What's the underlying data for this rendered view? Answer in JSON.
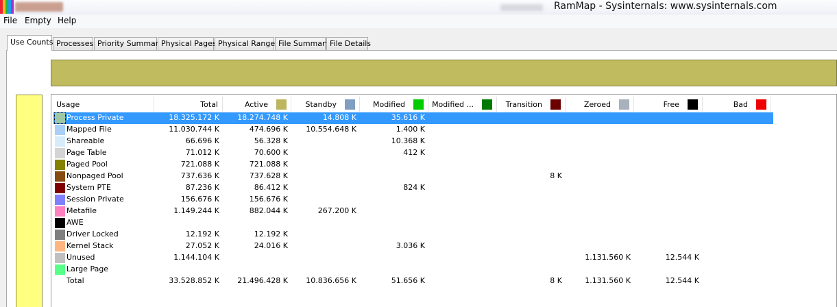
{
  "window": {
    "title": "RamMap - Sysinternals: www.sysinternals.com",
    "icon": "rammap-app-icon"
  },
  "menu": {
    "items": [
      "File",
      "Empty",
      "Help"
    ]
  },
  "tabs": [
    {
      "label": "Use Counts",
      "active": true
    },
    {
      "label": "Processes"
    },
    {
      "label": "Priority Summary"
    },
    {
      "label": "Physical Pages"
    },
    {
      "label": "Physical Ranges"
    },
    {
      "label": "File Summary"
    },
    {
      "label": "File Details"
    }
  ],
  "columns": [
    {
      "label": "Usage",
      "color": null
    },
    {
      "label": "Total",
      "color": null
    },
    {
      "label": "Active",
      "color": "#bdb65f"
    },
    {
      "label": "Standby",
      "color": "#7f9ec1"
    },
    {
      "label": "Modified",
      "color": "#00cc00"
    },
    {
      "label": "Modified ...",
      "color": "#007a00"
    },
    {
      "label": "Transition",
      "color": "#6b0000"
    },
    {
      "label": "Zeroed",
      "color": "#a9b1bd"
    },
    {
      "label": "Free",
      "color": "#000000"
    },
    {
      "label": "Bad",
      "color": "#ee0000"
    }
  ],
  "rows": [
    {
      "usage": "Process Private",
      "color": "#9ec7a6",
      "selected": true,
      "total": "18.325.172 K",
      "active": "18.274.748 K",
      "standby": "14.808 K",
      "modified": "35.616 K",
      "modified_nw": "",
      "transition": "",
      "zeroed": "",
      "free": "",
      "bad": ""
    },
    {
      "usage": "Mapped File",
      "color": "#a9cff6",
      "total": "11.030.744 K",
      "active": "474.696 K",
      "standby": "10.554.648 K",
      "modified": "1.400 K",
      "modified_nw": "",
      "transition": "",
      "zeroed": "",
      "free": "",
      "bad": ""
    },
    {
      "usage": "Shareable",
      "color": "#d6ecfb",
      "total": "66.696 K",
      "active": "56.328 K",
      "standby": "",
      "modified": "10.368 K",
      "modified_nw": "",
      "transition": "",
      "zeroed": "",
      "free": "",
      "bad": ""
    },
    {
      "usage": "Page Table",
      "color": "#d4d4d4",
      "total": "71.012 K",
      "active": "70.600 K",
      "standby": "",
      "modified": "412 K",
      "modified_nw": "",
      "transition": "",
      "zeroed": "",
      "free": "",
      "bad": ""
    },
    {
      "usage": "Paged Pool",
      "color": "#858200",
      "total": "721.088 K",
      "active": "721.088 K",
      "standby": "",
      "modified": "",
      "modified_nw": "",
      "transition": "",
      "zeroed": "",
      "free": "",
      "bad": ""
    },
    {
      "usage": "Nonpaged Pool",
      "color": "#864b10",
      "total": "737.636 K",
      "active": "737.628 K",
      "standby": "",
      "modified": "",
      "modified_nw": "",
      "transition": "8 K",
      "zeroed": "",
      "free": "",
      "bad": ""
    },
    {
      "usage": "System PTE",
      "color": "#7f0000",
      "total": "87.236 K",
      "active": "86.412 K",
      "standby": "",
      "modified": "824 K",
      "modified_nw": "",
      "transition": "",
      "zeroed": "",
      "free": "",
      "bad": ""
    },
    {
      "usage": "Session Private",
      "color": "#8080ff",
      "total": "156.676 K",
      "active": "156.676 K",
      "standby": "",
      "modified": "",
      "modified_nw": "",
      "transition": "",
      "zeroed": "",
      "free": "",
      "bad": ""
    },
    {
      "usage": "Metafile",
      "color": "#ff80c0",
      "total": "1.149.244 K",
      "active": "882.044 K",
      "standby": "267.200 K",
      "modified": "",
      "modified_nw": "",
      "transition": "",
      "zeroed": "",
      "free": "",
      "bad": ""
    },
    {
      "usage": "AWE",
      "color": "#000000",
      "total": "",
      "active": "",
      "standby": "",
      "modified": "",
      "modified_nw": "",
      "transition": "",
      "zeroed": "",
      "free": "",
      "bad": ""
    },
    {
      "usage": "Driver Locked",
      "color": "#7f7f7f",
      "total": "12.192 K",
      "active": "12.192 K",
      "standby": "",
      "modified": "",
      "modified_nw": "",
      "transition": "",
      "zeroed": "",
      "free": "",
      "bad": ""
    },
    {
      "usage": "Kernel Stack",
      "color": "#ffb57f",
      "total": "27.052 K",
      "active": "24.016 K",
      "standby": "",
      "modified": "3.036 K",
      "modified_nw": "",
      "transition": "",
      "zeroed": "",
      "free": "",
      "bad": ""
    },
    {
      "usage": "Unused",
      "color": "#c0c0c0",
      "total": "1.144.104 K",
      "active": "",
      "standby": "",
      "modified": "",
      "modified_nw": "",
      "transition": "",
      "zeroed": "1.131.560 K",
      "free": "12.544 K",
      "bad": ""
    },
    {
      "usage": "Large Page",
      "color": "#55ff88",
      "total": "",
      "active": "",
      "standby": "",
      "modified": "",
      "modified_nw": "",
      "transition": "",
      "zeroed": "",
      "free": "",
      "bad": ""
    },
    {
      "usage": "Total",
      "color": null,
      "total": "33.528.852 K",
      "active": "21.496.428 K",
      "standby": "10.836.656 K",
      "modified": "51.656 K",
      "modified_nw": "",
      "transition": "8 K",
      "zeroed": "1.131.560 K",
      "free": "12.544 K",
      "bad": ""
    }
  ],
  "summary_bars": {
    "active_bar_color": "#c0bb5f",
    "vertical_bar_color": "#ffff80"
  }
}
